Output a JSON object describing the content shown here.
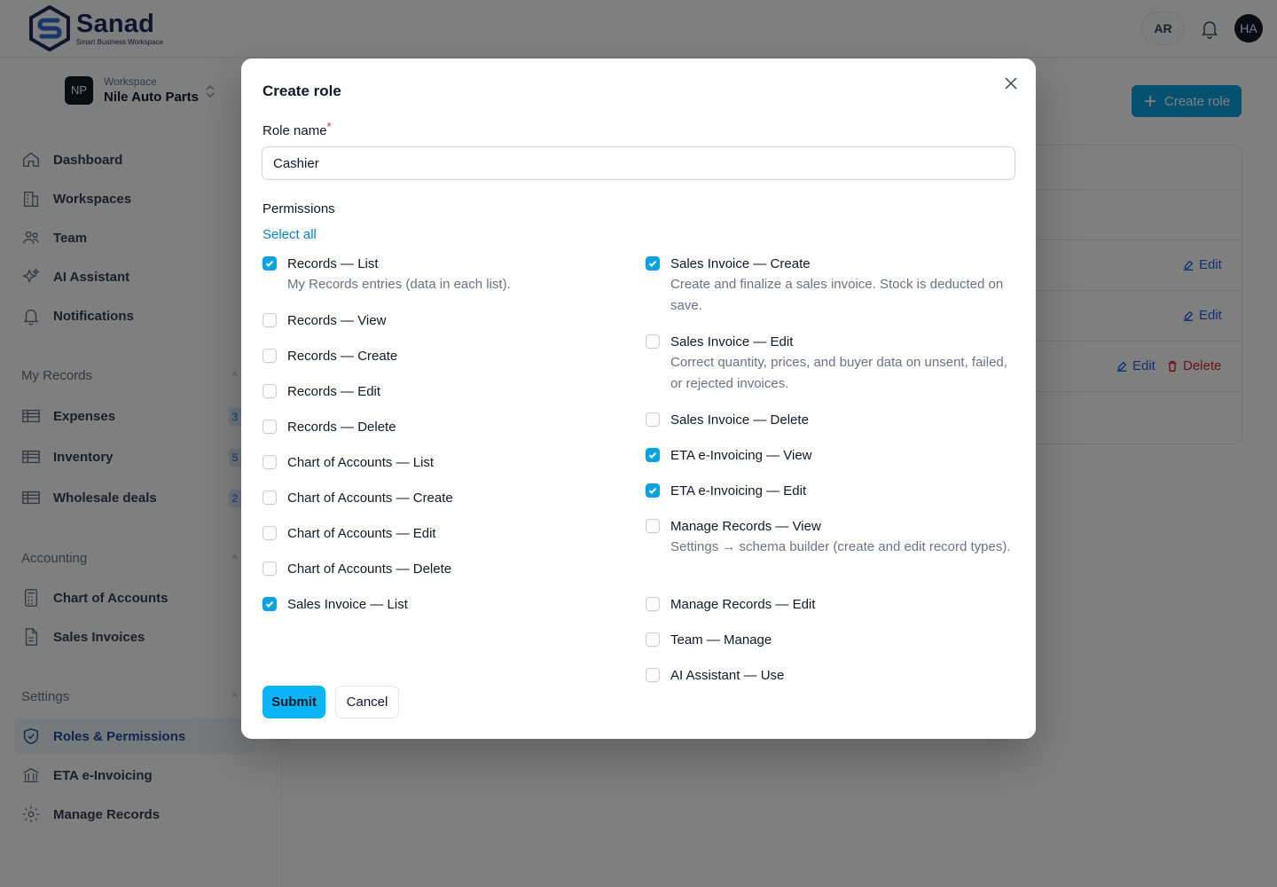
{
  "brand": {
    "name": "Sanad",
    "tagline": "Smart Business Workspace",
    "color": "#1e2a5a"
  },
  "header": {
    "language": "AR",
    "user_initials": "HA"
  },
  "workspace": {
    "label": "Workspace",
    "name": "Nile Auto Parts",
    "initials": "NP"
  },
  "sidebar": {
    "main": [
      {
        "label": "Dashboard",
        "icon": "home-icon"
      },
      {
        "label": "Workspaces",
        "icon": "building-icon"
      },
      {
        "label": "Team",
        "icon": "users-icon"
      },
      {
        "label": "AI Assistant",
        "icon": "sparkles-icon"
      },
      {
        "label": "Notifications",
        "icon": "bell-icon"
      }
    ],
    "my_records": {
      "title": "My Records",
      "items": [
        {
          "label": "Expenses",
          "count": "3"
        },
        {
          "label": "Inventory",
          "count": "5"
        },
        {
          "label": "Wholesale deals",
          "count": "2"
        }
      ]
    },
    "accounting": {
      "title": "Accounting",
      "items": [
        {
          "label": "Chart of Accounts"
        },
        {
          "label": "Sales Invoices"
        }
      ]
    },
    "settings": {
      "title": "Settings",
      "items": [
        {
          "label": "Roles & Permissions"
        },
        {
          "label": "ETA e-Invoicing"
        },
        {
          "label": "Manage Records"
        }
      ]
    }
  },
  "main": {
    "create_role_button": "Create role",
    "row_actions": {
      "edit": "Edit",
      "delete": "Delete"
    }
  },
  "modal": {
    "title": "Create role",
    "role_name_label": "Role name",
    "required_mark": "*",
    "role_name_value": "Cashier",
    "permissions_label": "Permissions",
    "select_all": "Select all",
    "submit": "Submit",
    "cancel": "Cancel",
    "permissions_left": [
      {
        "name": "Records — List",
        "checked": true,
        "desc": "My Records entries (data in each list)."
      },
      {
        "name": "Records — View",
        "checked": false
      },
      {
        "name": "Records — Create",
        "checked": false
      },
      {
        "name": "Records — Edit",
        "checked": false
      },
      {
        "name": "Records — Delete",
        "checked": false
      },
      {
        "name": "Chart of Accounts — List",
        "checked": false
      },
      {
        "name": "Chart of Accounts — Create",
        "checked": false
      },
      {
        "name": "Chart of Accounts — Edit",
        "checked": false
      },
      {
        "name": "Chart of Accounts — Delete",
        "checked": false
      },
      {
        "name": "Sales Invoice — List",
        "checked": true
      }
    ],
    "permissions_right": [
      {
        "name": "Sales Invoice — Create",
        "checked": true,
        "desc": "Create and finalize a sales invoice. Stock is deducted on save."
      },
      {
        "name": "Sales Invoice — Edit",
        "checked": false,
        "desc": "Correct quantity, prices, and buyer data on unsent, failed, or rejected invoices."
      },
      {
        "name": "Sales Invoice — Delete",
        "checked": false
      },
      {
        "name": "ETA e-Invoicing — View",
        "checked": true
      },
      {
        "name": "ETA e-Invoicing — Edit",
        "checked": true
      },
      {
        "name": "Manage Records — View",
        "checked": false,
        "desc": "Settings → schema builder (create and edit record types)."
      },
      {
        "name": "Manage Records — Edit",
        "checked": false
      },
      {
        "name": "Team — Manage",
        "checked": false
      },
      {
        "name": "AI Assistant — Use",
        "checked": false
      }
    ]
  },
  "colors": {
    "accent": "#0aa3e0",
    "link": "#0284c7",
    "danger": "#dc2626"
  }
}
